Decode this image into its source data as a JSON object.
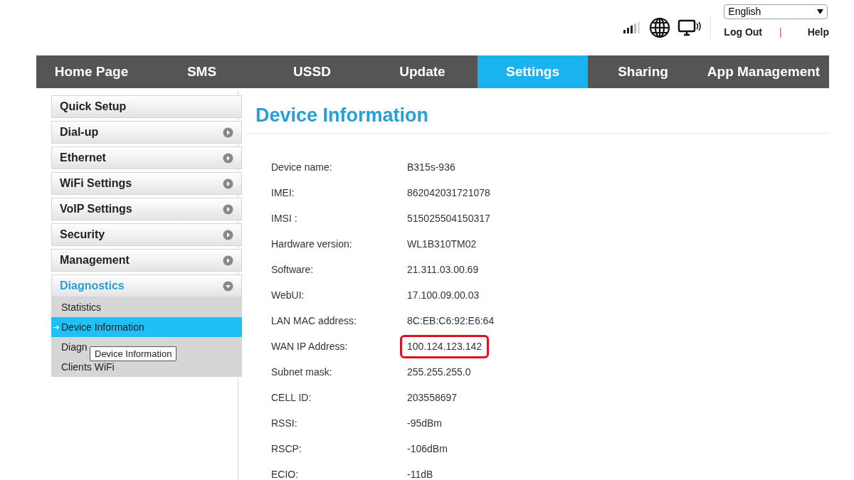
{
  "header": {
    "language": "English",
    "links": [
      "Log Out",
      "Help"
    ],
    "separator": "|"
  },
  "tabs": [
    {
      "label": "Home Page",
      "selected": false
    },
    {
      "label": "SMS",
      "selected": false
    },
    {
      "label": "USSD",
      "selected": false
    },
    {
      "label": "Update",
      "selected": false
    },
    {
      "label": "Settings",
      "selected": true
    },
    {
      "label": "Sharing",
      "selected": false
    },
    {
      "label": "App Management",
      "selected": false
    }
  ],
  "sidebar": {
    "items": [
      {
        "label": "Quick Setup",
        "kind": "plain"
      },
      {
        "label": "Dial-up",
        "kind": "collapsible",
        "expanded": false
      },
      {
        "label": "Ethernet",
        "kind": "collapsible",
        "expanded": false
      },
      {
        "label": "WiFi Settings",
        "kind": "collapsible",
        "expanded": false
      },
      {
        "label": "VoIP Settings",
        "kind": "collapsible",
        "expanded": false
      },
      {
        "label": "Security",
        "kind": "collapsible",
        "expanded": false
      },
      {
        "label": "Management",
        "kind": "collapsible",
        "expanded": false
      },
      {
        "label": "Diagnostics",
        "kind": "collapsible",
        "expanded": true,
        "children": [
          {
            "label": "Statistics",
            "selected": false
          },
          {
            "label": "Device Information",
            "selected": true
          },
          {
            "label": "Diagn",
            "selected": false,
            "tooltip": "Device Information"
          },
          {
            "label": "Clients WiFi",
            "selected": false
          }
        ]
      }
    ]
  },
  "content": {
    "title": "Device Information",
    "rows": [
      {
        "label": "Device name:",
        "value": "B315s-936",
        "highlighted": false
      },
      {
        "label": "IMEI:",
        "value": "862042031721078",
        "highlighted": false
      },
      {
        "label": "IMSI :",
        "value": "515025504150317",
        "highlighted": false
      },
      {
        "label": "Hardware version:",
        "value": "WL1B310TM02",
        "highlighted": false
      },
      {
        "label": "Software:",
        "value": "21.311.03.00.69",
        "highlighted": false
      },
      {
        "label": "WebUI:",
        "value": "17.100.09.00.03",
        "highlighted": false
      },
      {
        "label": "LAN MAC address:",
        "value": "8C:EB:C6:92:E6:64",
        "highlighted": false
      },
      {
        "label": "WAN IP Address:",
        "value": "100.124.123.142",
        "highlighted": true
      },
      {
        "label": "Subnet mask:",
        "value": "255.255.255.0",
        "highlighted": false
      },
      {
        "label": "CELL ID:",
        "value": "203558697",
        "highlighted": false
      },
      {
        "label": "RSSI:",
        "value": "-95dBm",
        "highlighted": false
      },
      {
        "label": "RSCP:",
        "value": "-106dBm",
        "highlighted": false
      },
      {
        "label": "ECIO:",
        "value": "-11dB",
        "highlighted": false
      }
    ]
  }
}
